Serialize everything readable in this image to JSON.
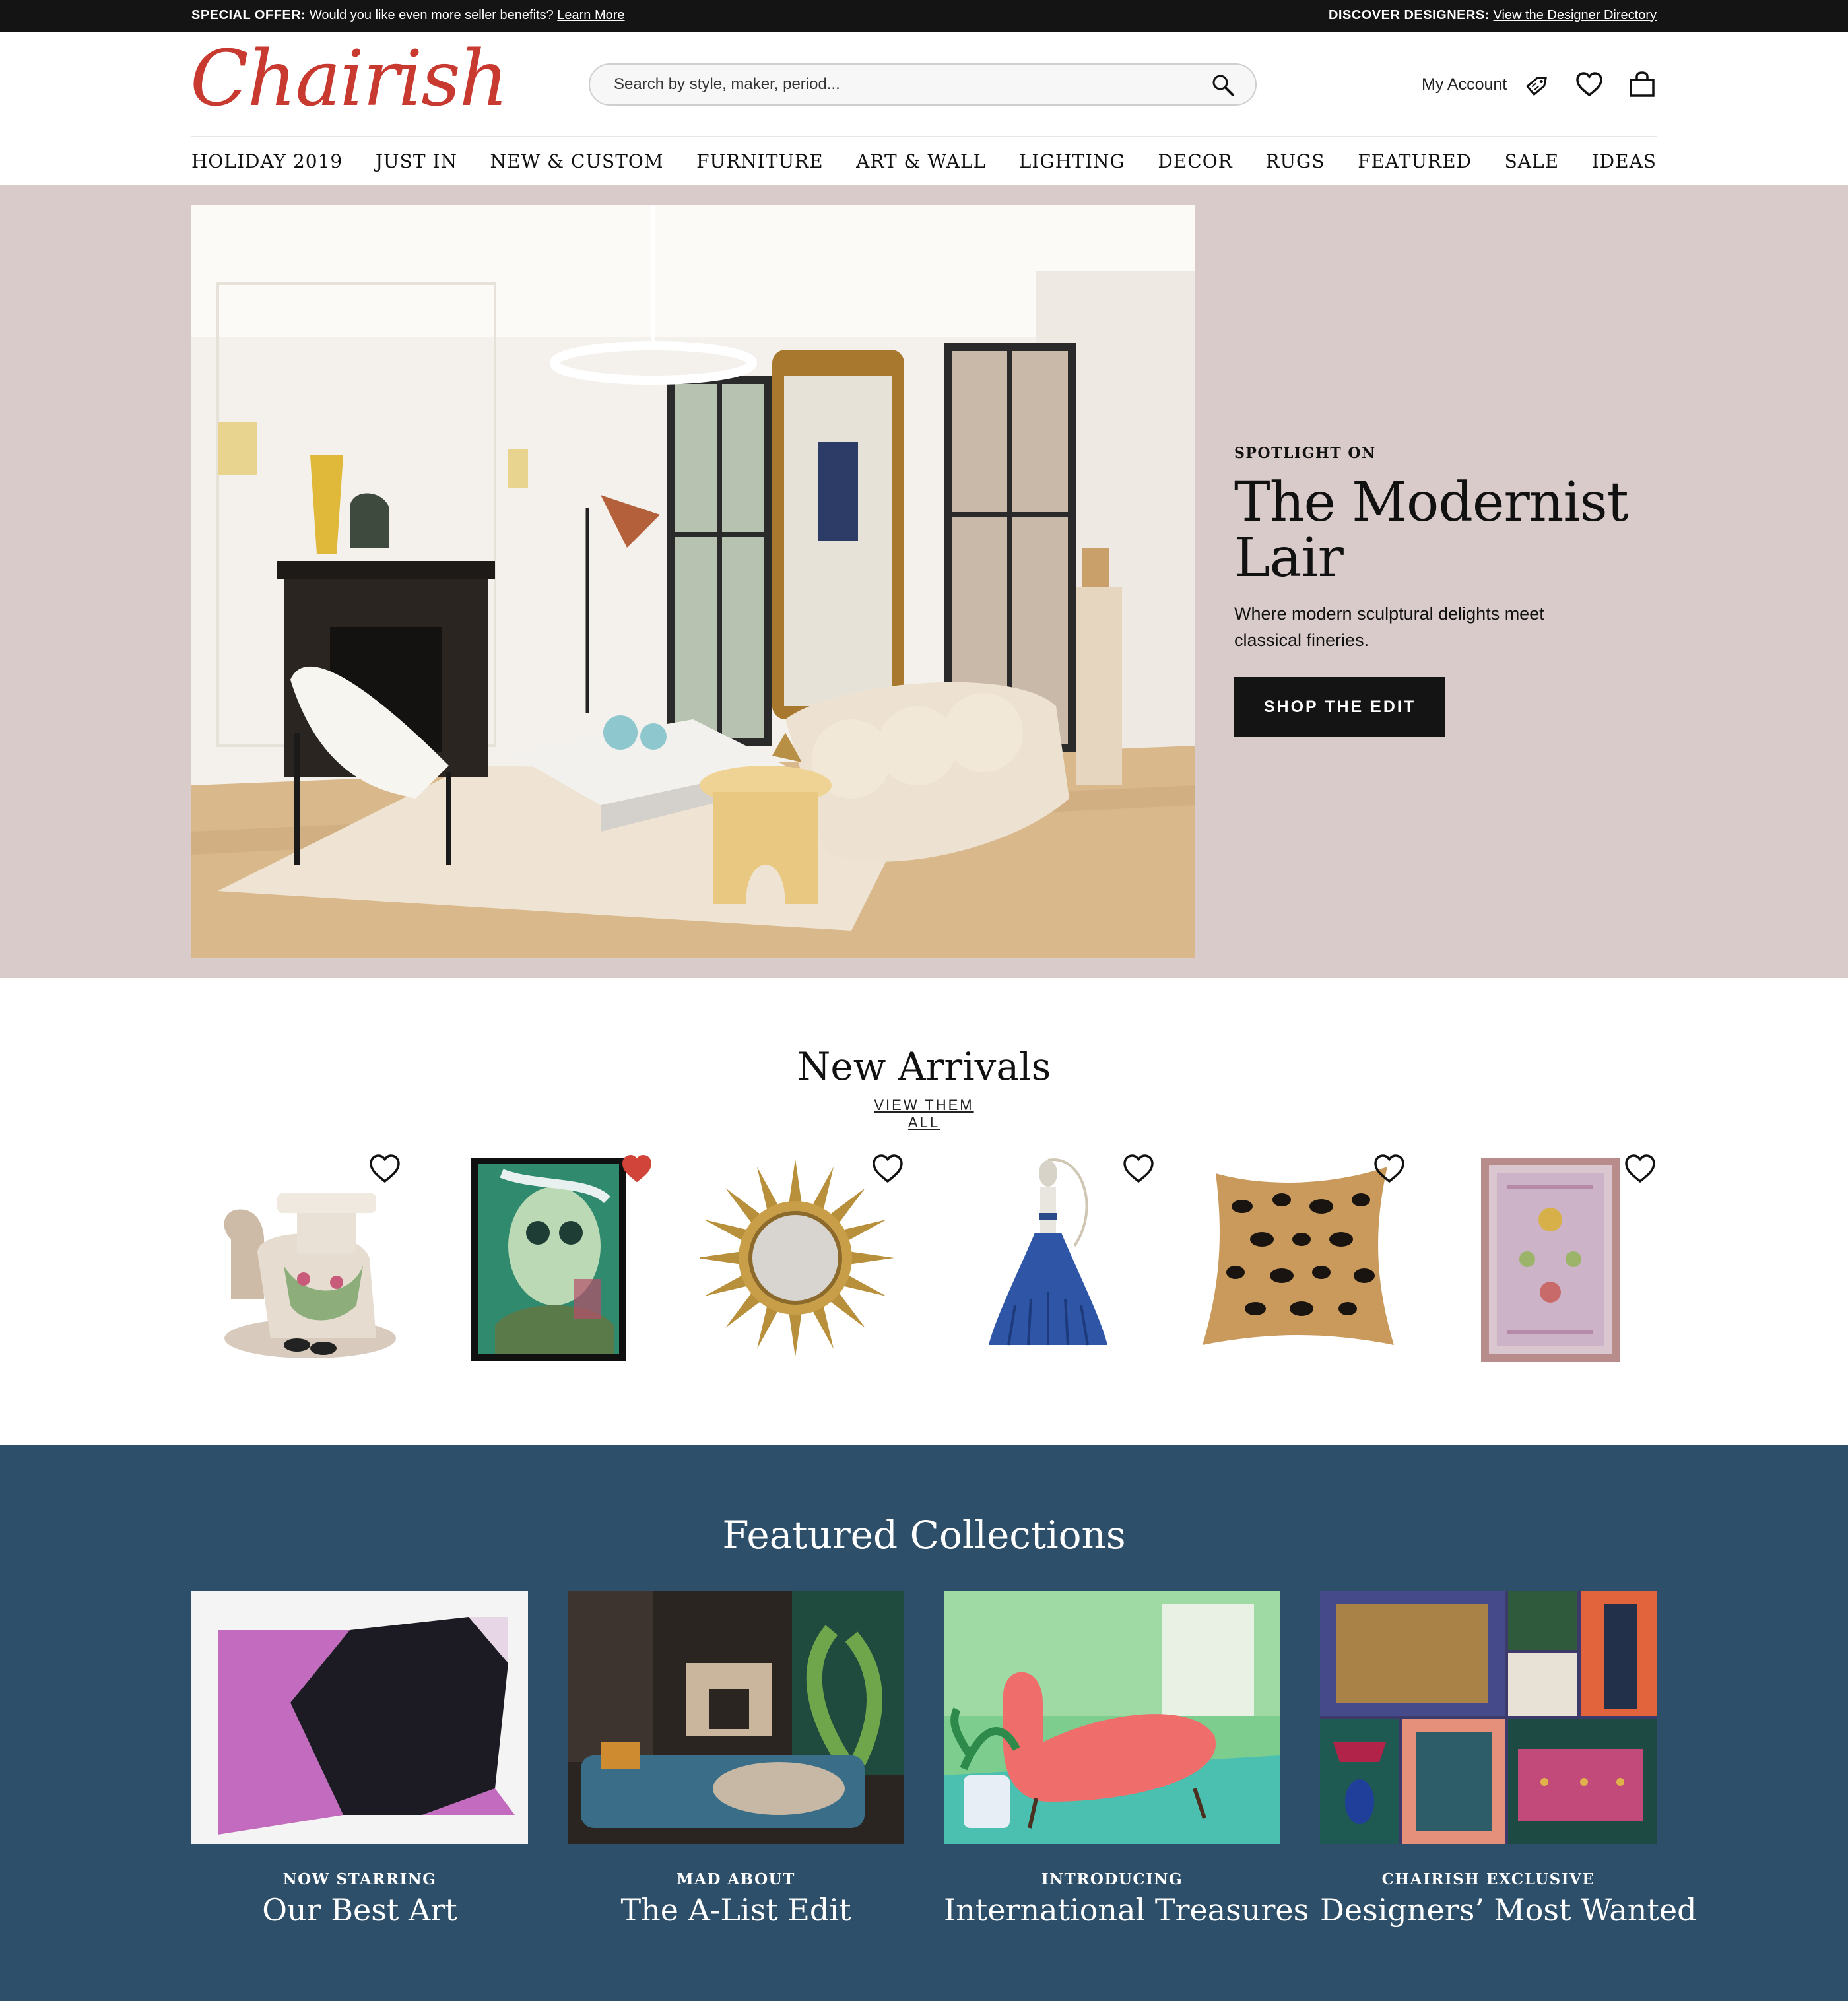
{
  "promo": {
    "left_label": "SPECIAL OFFER:",
    "left_text": "Would you like even more seller benefits?",
    "left_link": "Learn More",
    "right_label": "DISCOVER DESIGNERS:",
    "right_link": "View the Designer Directory"
  },
  "header": {
    "logo": "Chairish",
    "search_placeholder": "Search by style, maker, period...",
    "account_label": "My Account",
    "icons": [
      "search-icon",
      "price-tag-icon",
      "heart-icon",
      "shopping-bag-icon"
    ]
  },
  "nav": [
    "HOLIDAY 2019",
    "JUST IN",
    "NEW & CUSTOM",
    "FURNITURE",
    "ART & WALL",
    "LIGHTING",
    "DECOR",
    "RUGS",
    "FEATURED",
    "SALE",
    "IDEAS"
  ],
  "hero": {
    "eyebrow": "SPOTLIGHT ON",
    "title_line1": "The Modernist",
    "title_line2": "Lair",
    "subtitle": "Where modern sculptural delights meet classical fineries.",
    "button": "SHOP THE EDIT",
    "background_color": "#d9cbca"
  },
  "new_arrivals": {
    "title": "New Arrivals",
    "link": "VIEW THEM ALL",
    "items": [
      {
        "name": "camel-garden-stool",
        "favorited": false
      },
      {
        "name": "portrait-painting",
        "favorited": true
      },
      {
        "name": "sunburst-mirror",
        "favorited": false
      },
      {
        "name": "blue-tassel",
        "favorited": false
      },
      {
        "name": "leopard-pillow",
        "favorited": false
      },
      {
        "name": "oushak-rug",
        "favorited": false
      }
    ]
  },
  "featured": {
    "title": "Featured Collections",
    "background_color": "#2e4f69",
    "cards": [
      {
        "eyebrow": "NOW STARRING",
        "name": "Our Best Art"
      },
      {
        "eyebrow": "MAD ABOUT",
        "name": "The A-List Edit"
      },
      {
        "eyebrow": "INTRODUCING",
        "name": "International Treasures"
      },
      {
        "eyebrow": "CHAIRISH EXCLUSIVE",
        "name": "Designers’ Most Wanted"
      }
    ]
  },
  "colors": {
    "brand": "#c8392f",
    "favorite": "#d0443a",
    "dark": "#141414"
  }
}
